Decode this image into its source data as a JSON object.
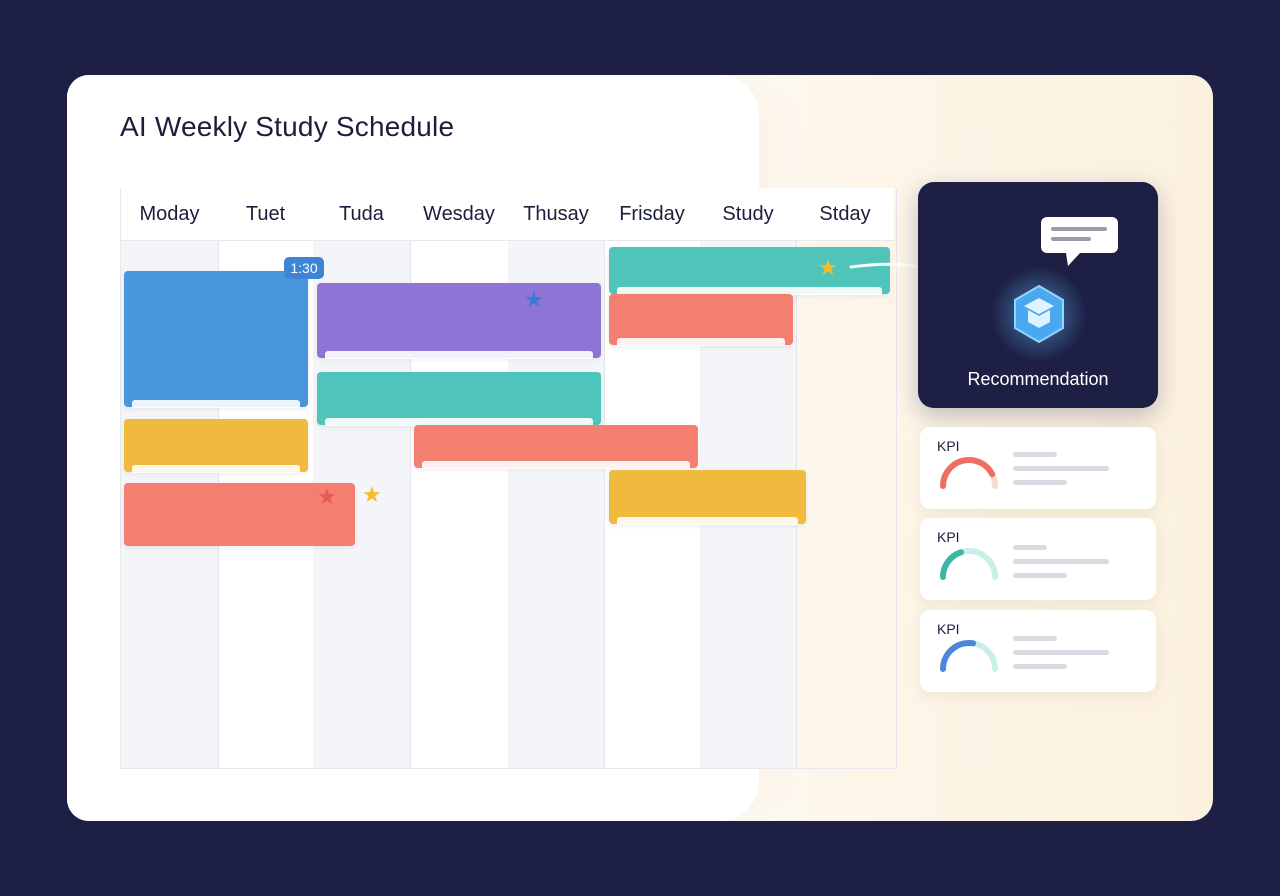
{
  "title": "AI Weekly Study Schedule",
  "days": [
    "Moday",
    "Tuet",
    "Tuda",
    "Wesday",
    "Thusay",
    "Frisday",
    "Study",
    "Stday"
  ],
  "time_badge": "1:30",
  "recommendation": {
    "label": "Recommendation",
    "icon": "graduation-cap-icon",
    "bubble_icon": "speech-bubble-icon"
  },
  "kpis": [
    {
      "label": "KPI",
      "value": 0.85,
      "color": "#ef6e62",
      "track": "#f7d9d3"
    },
    {
      "label": "KPI",
      "value": 0.4,
      "color": "#3db5a7",
      "track": "#c9efe9"
    },
    {
      "label": "KPI",
      "value": 0.55,
      "color": "#4b86dc",
      "track": "#c9efe9"
    }
  ],
  "colors": {
    "blue": "#4a96dc",
    "purple": "#8f74d6",
    "teal": "#4fc4ba",
    "salmon": "#f47e70",
    "yellow": "#f0ba3e",
    "star_gold": "#f5bc2c",
    "star_red": "#e65a55",
    "star_blue": "#3b78d8",
    "background": "#1d1f45"
  }
}
